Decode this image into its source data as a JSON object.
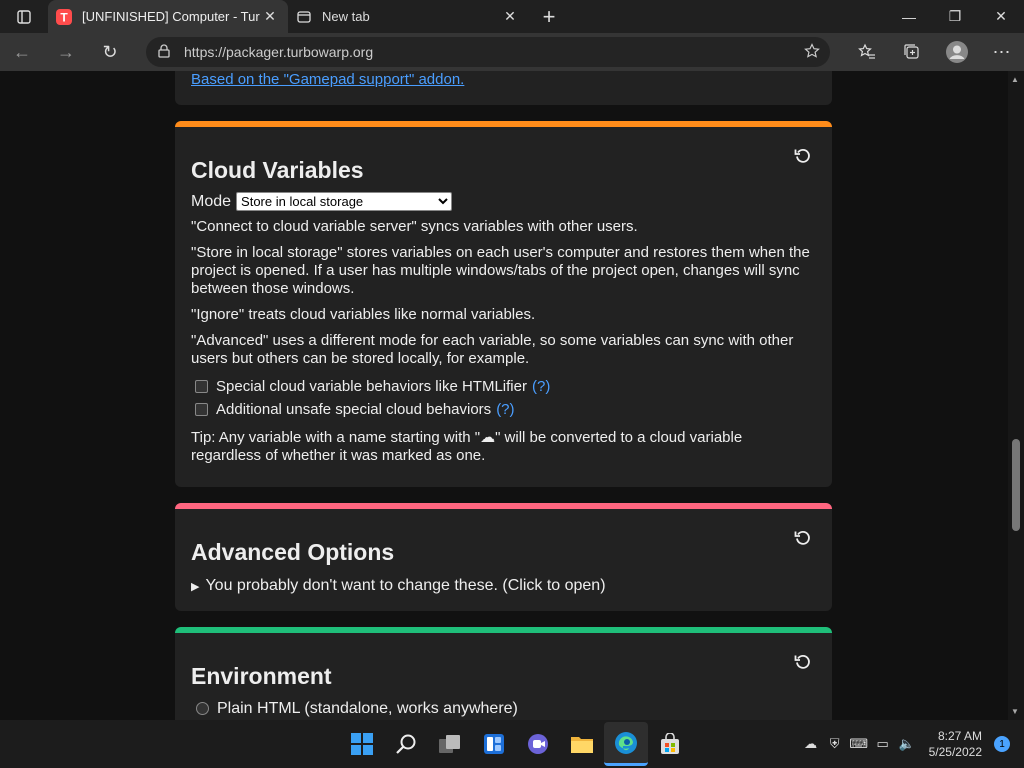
{
  "browser": {
    "tabs": [
      {
        "title": "[UNFINISHED] Computer - Turbo",
        "active": true
      },
      {
        "title": "New tab",
        "active": false
      }
    ],
    "url": "https://packager.turbowarp.org"
  },
  "page": {
    "prev_card_link": "Based on the \"Gamepad support\" addon.",
    "cloud": {
      "title": "Cloud Variables",
      "accent": "#ff8c1a",
      "mode_label": "Mode",
      "mode_selected": "Store in local storage",
      "p_connect": "\"Connect to cloud variable server\" syncs variables with other users.",
      "p_store": "\"Store in local storage\" stores variables on each user's computer and restores them when the project is opened. If a user has multiple windows/tabs of the project open, changes will sync between those windows.",
      "p_ignore": "\"Ignore\" treats cloud variables like normal variables.",
      "p_advanced": "\"Advanced\" uses a different mode for each variable, so some variables can sync with other users but others can be stored locally, for example.",
      "cb1": "Special cloud variable behaviors like HTMLifier",
      "cb2": "Additional unsafe special cloud behaviors",
      "help": "(?)",
      "tip": "Tip: Any variable with a name starting with \"☁\" will be converted to a cloud variable regardless of whether it was marked as one."
    },
    "advanced": {
      "title": "Advanced Options",
      "accent": "#ff6680",
      "summary": "You probably don't want to change these. (Click to open)"
    },
    "environment": {
      "title": "Environment",
      "accent": "#1fbf7a",
      "option1": "Plain HTML (standalone, works anywhere)"
    }
  },
  "taskbar": {
    "time": "8:27 AM",
    "date": "5/25/2022",
    "notifications": "1"
  }
}
